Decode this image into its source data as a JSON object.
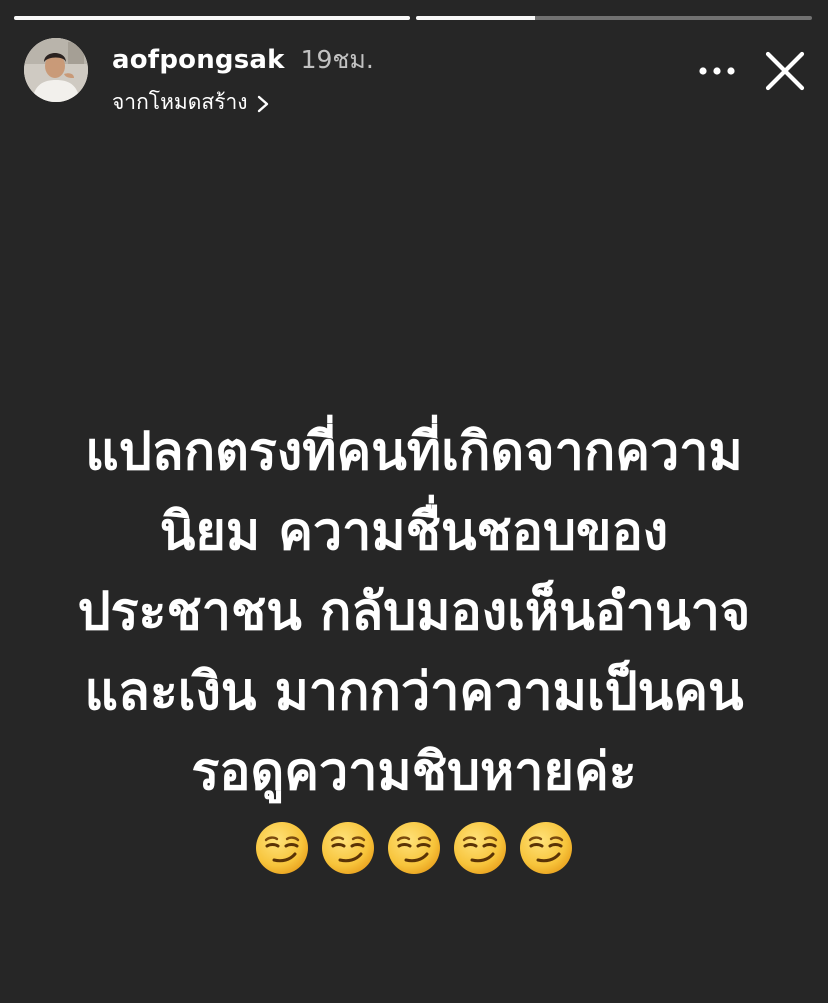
{
  "progress": {
    "segments": [
      {
        "fill": 1.0
      },
      {
        "fill": 0.3
      }
    ]
  },
  "header": {
    "username": "aofpongsak",
    "timestamp": "19ชม.",
    "source_label": "จากโหมดสร้าง"
  },
  "story": {
    "lines": [
      "แปลกตรงที่คนที่เกิดจากความ",
      "นิยม ความชื่นชอบของ",
      "ประชาชน กลับมองเห็นอำนาจ",
      "และเงิน มากกว่าความเป็นคน",
      "รอดูความชิบหายค่ะ"
    ],
    "emoji_count": 5,
    "emoji_name": "smirking-face-icon"
  },
  "colors": {
    "background": "#262626",
    "text": "#ffffff",
    "emoji_face": "#f7c43b"
  }
}
